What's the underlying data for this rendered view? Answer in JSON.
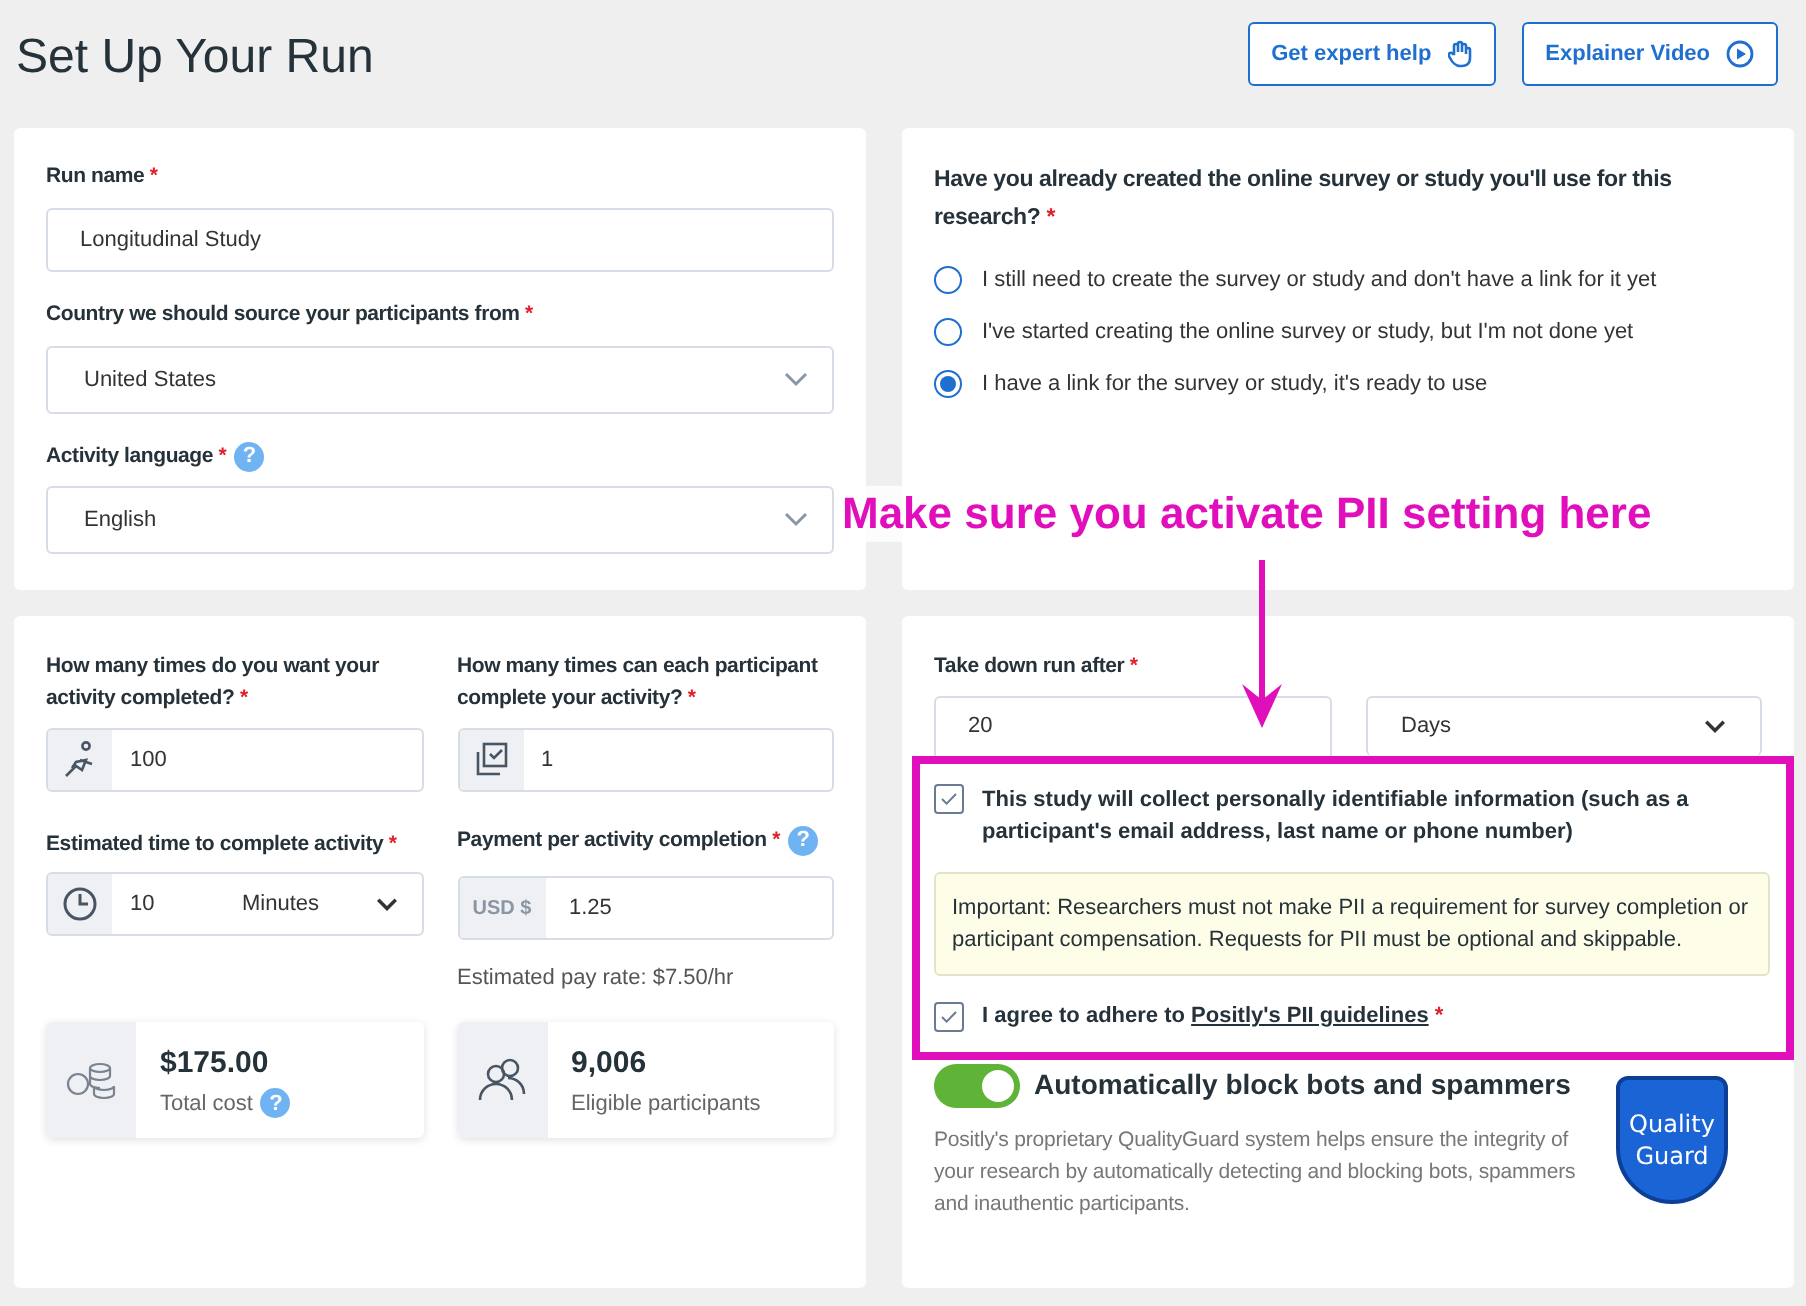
{
  "title": "Set Up Your Run",
  "header_buttons": [
    {
      "label": "Get expert help",
      "kind": "hand"
    },
    {
      "label": "Explainer Video",
      "kind": "play"
    }
  ],
  "run_name": {
    "label": "Run name",
    "required": "*",
    "value": "Longitudinal Study"
  },
  "country": {
    "label": "Country we should source your participants from",
    "required": "*",
    "value": "United States"
  },
  "language": {
    "label": "Activity language",
    "required": "*",
    "help": "?",
    "value": "English"
  },
  "survey_question": {
    "label": "Have you already created the online survey or study you'll use for this research?",
    "required": "*",
    "options": [
      {
        "label": "I still need to create the survey or study and don't have a link for it yet",
        "selected": false
      },
      {
        "label": "I've started creating the online survey or study, but I'm not done yet",
        "selected": false
      },
      {
        "label": "I have a link for the survey or study, it's ready to use",
        "selected": true
      }
    ]
  },
  "completions": {
    "label": "How many times do you want your activity completed?",
    "required": "*",
    "value": "100"
  },
  "per_participant": {
    "label": "How many times can each participant complete your activity?",
    "required": "*",
    "value": "1"
  },
  "estimated_time": {
    "label": "Estimated time to complete activity",
    "required": "*",
    "value": "10",
    "unit": "Minutes"
  },
  "payment": {
    "label": "Payment per activity completion",
    "required": "*",
    "help": "?",
    "currency": "USD $",
    "value": "1.25"
  },
  "pay_rate": "Estimated pay rate: $7.50/hr",
  "total_cost": {
    "value": "$175.00",
    "label": "Total cost",
    "help": "?"
  },
  "eligible": {
    "value": "9,006",
    "label": "Eligible participants"
  },
  "take_down": {
    "label": "Take down run after",
    "required": "*",
    "value": "20",
    "unit": "Days"
  },
  "pii": {
    "checked": true,
    "label": "This study will collect personally identifiable information (such as a participant's email address, last name or phone number)"
  },
  "notice": "Important:  Researchers must not make PII a requirement for survey completion or participant compensation. Requests for PII must be optional and skippable.",
  "agree": {
    "checked": true,
    "text": "I agree to adhere to",
    "link": "Positly's PII guidelines",
    "required": "*"
  },
  "bot_block": {
    "on": true,
    "label": "Automatically block bots and spammers",
    "description": "Positly's proprietary QualityGuard system helps ensure the integrity of your research by automatically detecting and blocking bots, spammers and inauthentic participants."
  },
  "logo": {
    "line1": "Quality",
    "line2": "Guard"
  },
  "annotation": "Make sure you activate PII setting here"
}
